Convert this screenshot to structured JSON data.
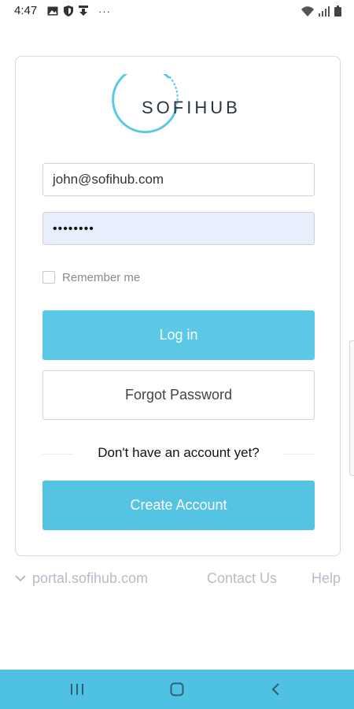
{
  "status_bar": {
    "time": "4:47",
    "more": "···",
    "icons": [
      "image-icon",
      "shield-icon",
      "download-icon",
      "wifi-icon",
      "signal-icon",
      "battery-icon"
    ]
  },
  "logo": {
    "text": "SOFIHUB",
    "accent_color": "#5bc8e6"
  },
  "login": {
    "email_value": "john@sofihub.com",
    "password_masked": "••••••••",
    "remember_label": "Remember me",
    "login_button": "Log in",
    "forgot_button": "Forgot Password",
    "no_account_text": "Don't have an account yet?",
    "create_button": "Create Account"
  },
  "footer": {
    "portal": "portal.sofihub.com",
    "contact": "Contact Us",
    "help": "Help"
  },
  "nav_bar": {
    "color": "#4fc1e2",
    "buttons": [
      "recent-apps-icon",
      "home-icon",
      "back-icon"
    ]
  }
}
